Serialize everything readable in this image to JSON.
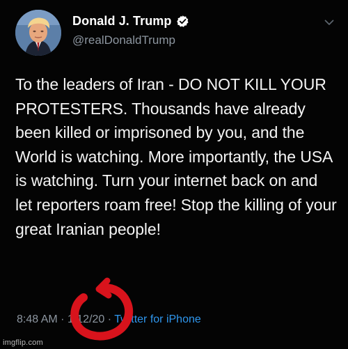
{
  "user": {
    "display_name": "Donald J. Trump",
    "handle": "@realDonaldTrump",
    "verified": true
  },
  "tweet": {
    "text": "To the leaders of Iran - DO NOT KILL YOUR PROTESTERS. Thousands have already been killed or imprisoned by you, and the World is watching. More importantly, the USA is watching. Turn your internet back on and let reporters roam free! Stop the killing of your great Iranian people!",
    "time": "8:48 AM",
    "date": "1/12/20",
    "separator": "·",
    "source": "Twitter for iPhone"
  },
  "watermark": "imgflip.com",
  "colors": {
    "background": "#040404",
    "text": "#f4f4f4",
    "muted": "#8d96a0",
    "link": "#2f97ee",
    "verified": "#ffffff",
    "annotation": "#d8131c"
  },
  "icons": {
    "verified": "verified-badge-icon",
    "menu": "chevron-down-icon"
  }
}
